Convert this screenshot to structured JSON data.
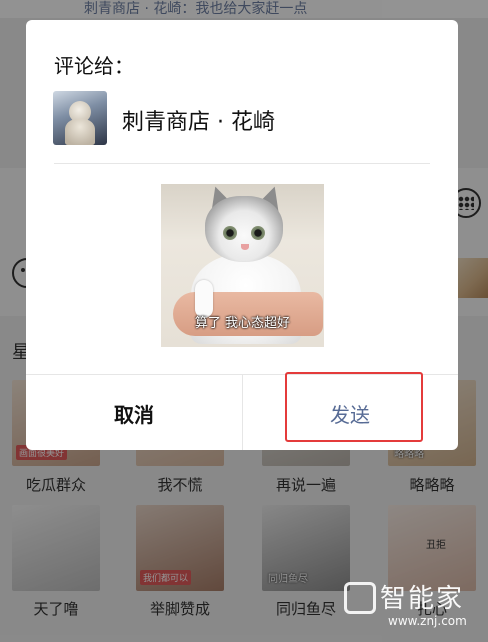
{
  "background": {
    "top_strip_text": "刺青商店 · 花崎：我也给大家赶一点",
    "section_label": "星",
    "stickers_row1": [
      {
        "caption": "吃瓜群众",
        "tag": "画面很美好"
      },
      {
        "caption": "我不慌",
        "tag": ""
      },
      {
        "caption": "再说一遍",
        "tag": ""
      },
      {
        "caption": "略略略",
        "tag": "略略略"
      }
    ],
    "stickers_row2": [
      {
        "caption": "天了噜",
        "tag": ""
      },
      {
        "caption": "举脚赞成",
        "tag": "我们都可以"
      },
      {
        "caption": "同归鱼尽",
        "tag": "同归鱼尽"
      },
      {
        "caption": "扎心",
        "tag": "丑拒"
      }
    ]
  },
  "dialog": {
    "title": "评论给：",
    "recipient_name": "刺青商店 · 花崎",
    "preview_caption": "算了 我心态超好",
    "cancel_label": "取消",
    "send_label": "发送"
  },
  "watermark": {
    "brand": "智能家",
    "url": "www.znj.com"
  },
  "colors": {
    "send_text": "#576b95",
    "highlight_box": "#e43b3b",
    "overlay": "rgba(0,0,0,0.42)"
  }
}
